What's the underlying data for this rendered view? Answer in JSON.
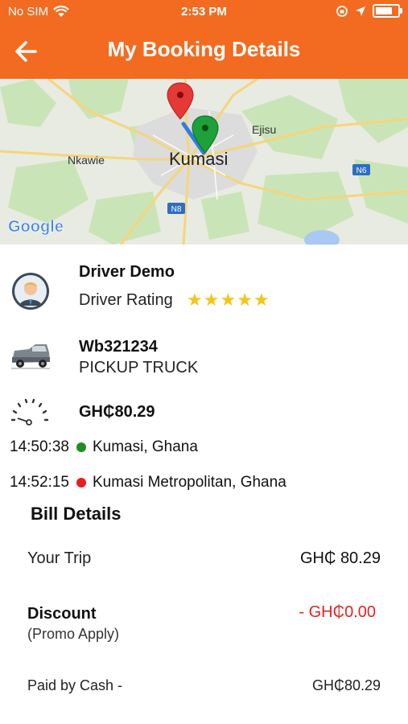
{
  "status_bar": {
    "carrier": "No SIM",
    "time": "2:53 PM",
    "battery_level": 0.9
  },
  "header": {
    "title": "My Booking Details",
    "back_icon": "arrow-left-icon"
  },
  "map": {
    "labels": {
      "city": "Kumasi",
      "nkawie": "Nkawie",
      "ejisu": "Ejisu",
      "n6": "N6",
      "n8": "N8",
      "google": "Google"
    },
    "pickup_pin_color": "#e53935",
    "dropoff_pin_color": "#1ea03a",
    "route_color": "#2f7de1"
  },
  "driver": {
    "name": "Driver Demo",
    "rating_label": "Driver Rating",
    "rating_stars": 5
  },
  "vehicle": {
    "plate": "Wb321234",
    "type": "PICKUP TRUCK"
  },
  "fare": {
    "amount": "GH₵80.29"
  },
  "trip": {
    "pickup": {
      "time": "14:50:38",
      "location": "Kumasi, Ghana",
      "color": "#1e8e1e"
    },
    "dropoff": {
      "time": "14:52:15",
      "location": "Kumasi Metropolitan, Ghana",
      "color": "#e51e1e"
    }
  },
  "bill": {
    "title": "Bill Details",
    "your_trip_label": "Your Trip",
    "your_trip_value": "GH₵ 80.29",
    "discount_label": "Discount",
    "discount_note": "(Promo Apply)",
    "discount_value": "- GH₵0.00",
    "paid_label": "Paid by Cash -",
    "paid_value": "GH₵80.29"
  },
  "colors": {
    "brand": "#f26b21",
    "star": "#f5c518",
    "discount": "#e52222"
  }
}
